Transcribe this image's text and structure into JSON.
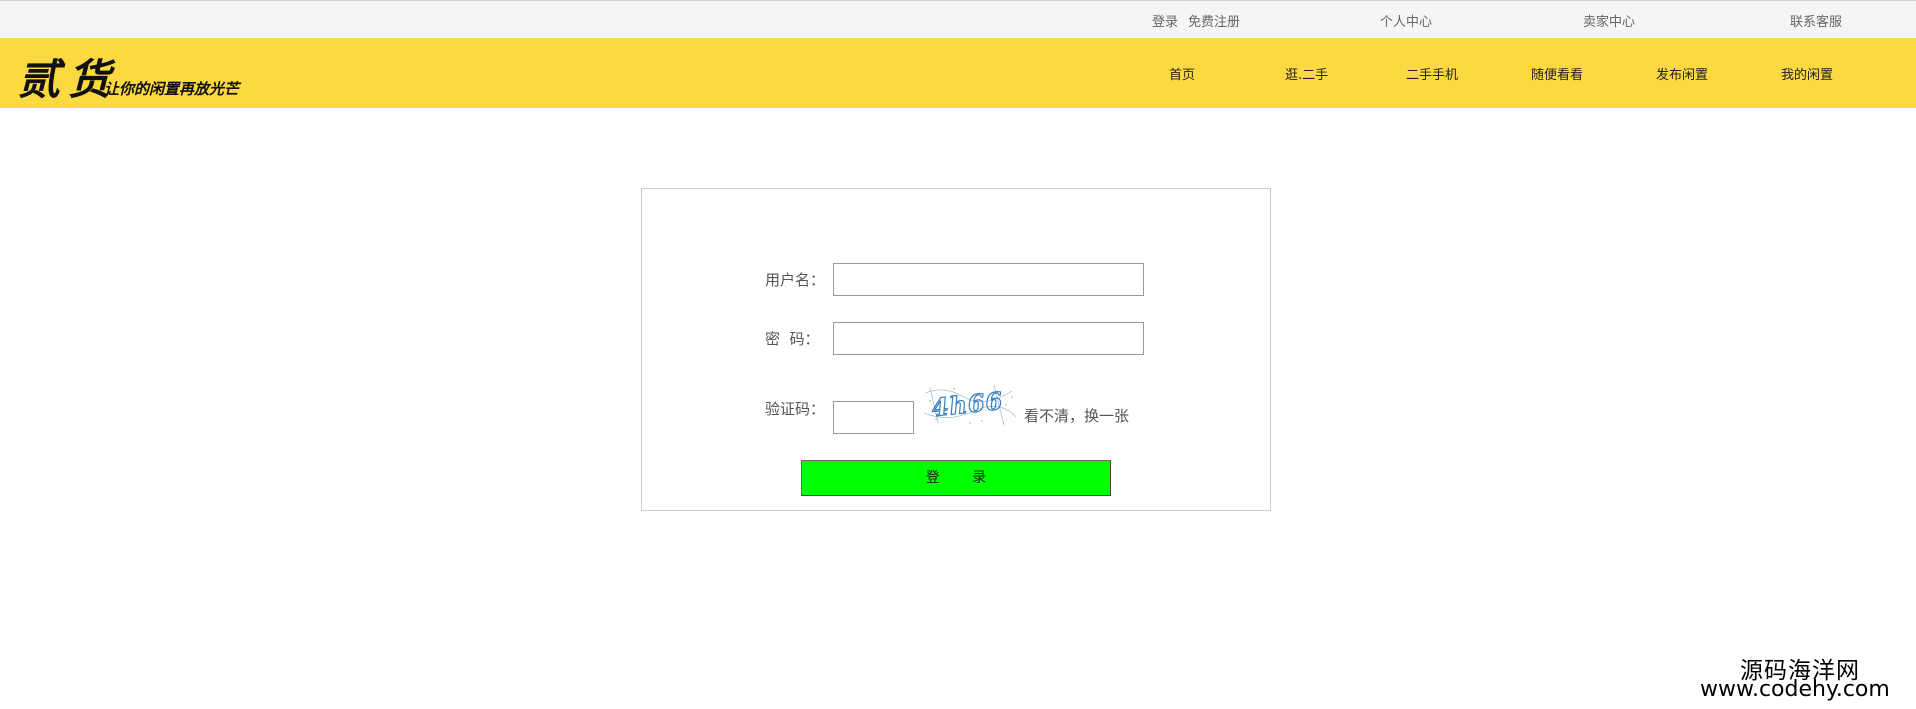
{
  "topbar": {
    "login": "登录",
    "register": "免费注册",
    "personal_center": "个人中心",
    "seller_center": "卖家中心",
    "contact_service": "联系客服"
  },
  "header": {
    "logo_text": "贰货",
    "slogan": "让你的闲置再放光芒",
    "nav": [
      "首页",
      "逛.二手",
      "二手手机",
      "随便看看",
      "发布闲置",
      "我的闲置"
    ],
    "background_color": "#fcd940"
  },
  "login_form": {
    "username_label": "用户名：",
    "username_value": "",
    "password_label": "密  码：",
    "password_value": "",
    "captcha_label": "验证码：",
    "captcha_value": "",
    "captcha_text": "4h66",
    "refresh_text": "看不清，换一张",
    "submit_label": "登 录",
    "submit_color": "#00ff00"
  },
  "watermark": {
    "cn": "源码海洋网",
    "en": "www.codehy.com"
  }
}
